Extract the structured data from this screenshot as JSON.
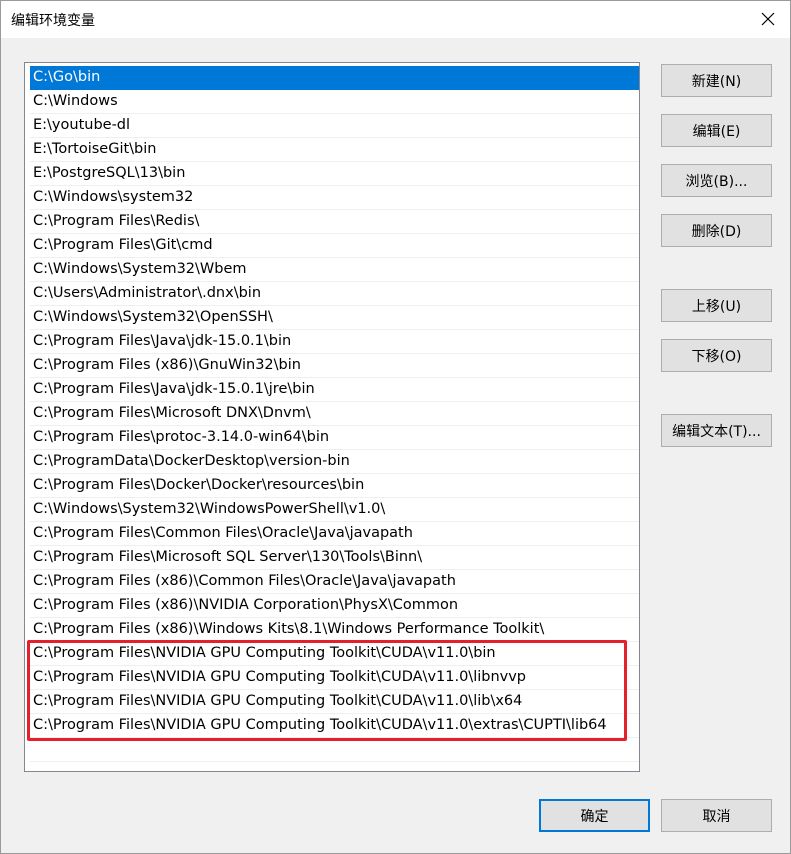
{
  "window": {
    "title": "编辑环境变量"
  },
  "paths": [
    "C:\\Go\\bin",
    "C:\\Windows",
    "E:\\youtube-dl",
    "E:\\TortoiseGit\\bin",
    "E:\\PostgreSQL\\13\\bin",
    "C:\\Windows\\system32",
    "C:\\Program Files\\Redis\\",
    "C:\\Program Files\\Git\\cmd",
    "C:\\Windows\\System32\\Wbem",
    "C:\\Users\\Administrator\\.dnx\\bin",
    "C:\\Windows\\System32\\OpenSSH\\",
    "C:\\Program Files\\Java\\jdk-15.0.1\\bin",
    "C:\\Program Files (x86)\\GnuWin32\\bin",
    "C:\\Program Files\\Java\\jdk-15.0.1\\jre\\bin",
    "C:\\Program Files\\Microsoft DNX\\Dnvm\\",
    "C:\\Program Files\\protoc-3.14.0-win64\\bin",
    "C:\\ProgramData\\DockerDesktop\\version-bin",
    "C:\\Program Files\\Docker\\Docker\\resources\\bin",
    "C:\\Windows\\System32\\WindowsPowerShell\\v1.0\\",
    "C:\\Program Files\\Common Files\\Oracle\\Java\\javapath",
    "C:\\Program Files\\Microsoft SQL Server\\130\\Tools\\Binn\\",
    "C:\\Program Files (x86)\\Common Files\\Oracle\\Java\\javapath",
    "C:\\Program Files (x86)\\NVIDIA Corporation\\PhysX\\Common",
    "C:\\Program Files (x86)\\Windows Kits\\8.1\\Windows Performance Toolkit\\",
    "C:\\Program Files\\NVIDIA GPU Computing Toolkit\\CUDA\\v11.0\\bin",
    "C:\\Program Files\\NVIDIA GPU Computing Toolkit\\CUDA\\v11.0\\libnvvp",
    "C:\\Program Files\\NVIDIA GPU Computing Toolkit\\CUDA\\v11.0\\lib\\x64",
    "C:\\Program Files\\NVIDIA GPU Computing Toolkit\\CUDA\\v11.0\\extras\\CUPTI\\lib64"
  ],
  "selected_index": 0,
  "buttons": {
    "new": "新建(N)",
    "edit": "编辑(E)",
    "browse": "浏览(B)...",
    "delete": "删除(D)",
    "move_up": "上移(U)",
    "move_down": "下移(O)",
    "edit_text": "编辑文本(T)...",
    "ok": "确定",
    "cancel": "取消"
  },
  "colors": {
    "selection": "#0078d7",
    "highlight_box": "#e5202a"
  }
}
